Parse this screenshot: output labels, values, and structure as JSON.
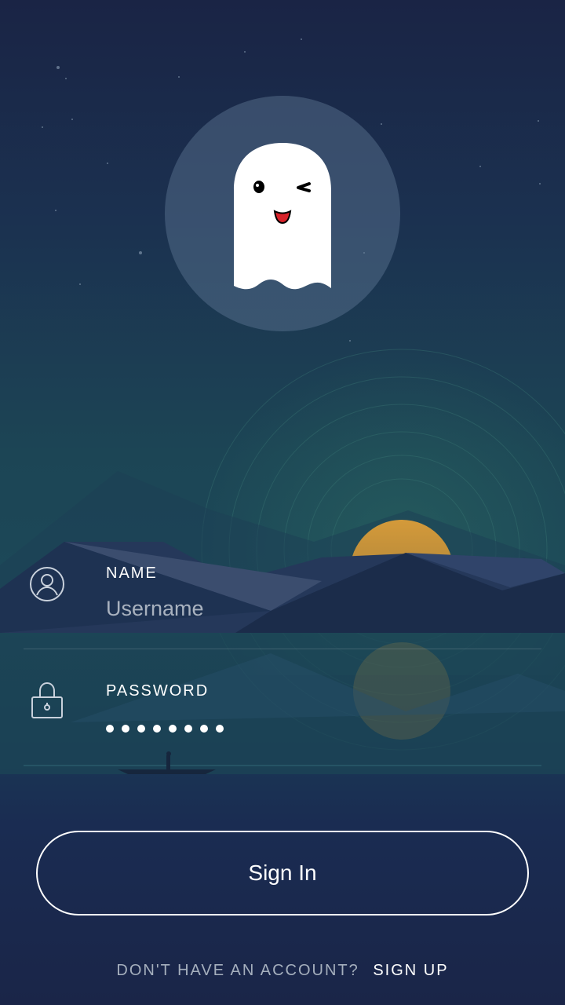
{
  "login": {
    "name_label": "NAME",
    "name_placeholder": "Username",
    "password_label": "PASSWORD",
    "password_masked_length": 8,
    "signin_label": "Sign In",
    "footer_question": "DON'T HAVE AN ACCOUNT?",
    "footer_link": "SIGN UP"
  },
  "icons": {
    "avatar": "ghost-icon",
    "name": "user-circle-icon",
    "password": "lock-icon"
  },
  "colors": {
    "background_top": "#1a2445",
    "background_mid": "#1c4555",
    "sun": "#c9953a",
    "text": "#ffffff",
    "muted_text": "#a5afbd"
  }
}
